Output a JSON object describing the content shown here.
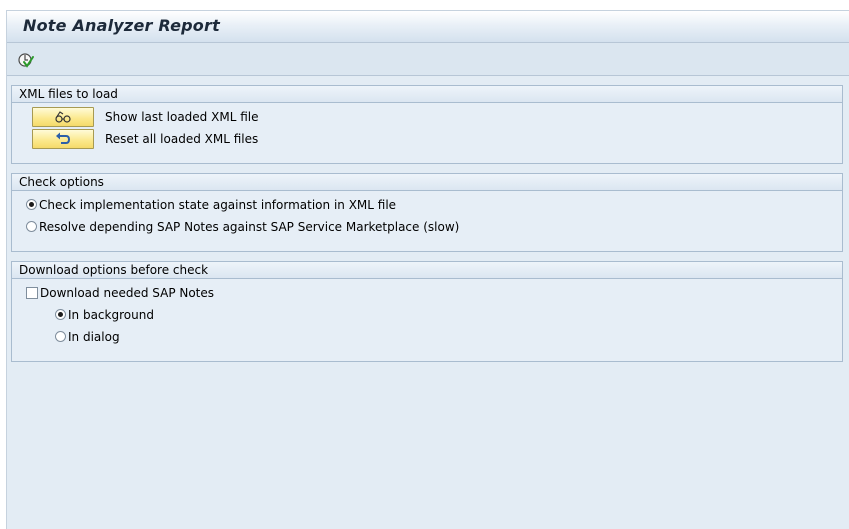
{
  "window": {
    "title": "Note Analyzer Report"
  },
  "toolbar": {
    "execute_icon": "execute-check-icon"
  },
  "xml_group": {
    "title": "XML files to load",
    "show_button_icon": "glasses-icon",
    "show_label": "Show last loaded XML file",
    "reset_button_icon": "undo-arrow-icon",
    "reset_label": "Reset all loaded XML files"
  },
  "check_group": {
    "title": "Check options",
    "options": [
      {
        "label": "Check implementation state against information in XML file",
        "selected": true
      },
      {
        "label": "Resolve depending SAP Notes against SAP Service Marketplace (slow)",
        "selected": false
      }
    ]
  },
  "download_group": {
    "title": "Download options before check",
    "download_checkbox": {
      "label": "Download needed SAP Notes",
      "checked": false
    },
    "modes": [
      {
        "label": "In background",
        "selected": true
      },
      {
        "label": "In dialog",
        "selected": false
      }
    ]
  },
  "colors": {
    "background": "#e3ecf4",
    "button_yellow": "#fbe88b",
    "group_border": "#a9bccf"
  }
}
